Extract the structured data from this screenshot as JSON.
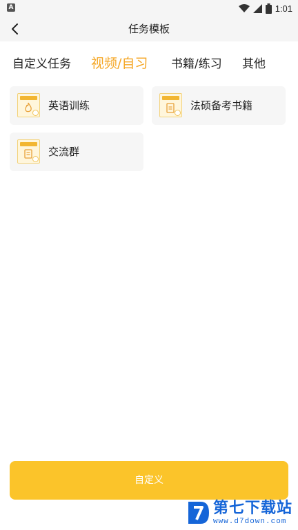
{
  "status_bar": {
    "time": "1:01",
    "icons": [
      "wifi-icon",
      "signal-icon",
      "battery-icon"
    ]
  },
  "header": {
    "title": "任务模板",
    "back_icon": "chevron-left-icon"
  },
  "tabs": [
    {
      "label": "自定义任务",
      "active": false
    },
    {
      "label": "视频/自习",
      "active": true
    },
    {
      "label": "书籍/练习",
      "active": false
    },
    {
      "label": "其他",
      "active": false
    }
  ],
  "templates": [
    {
      "label": "英语训练",
      "icon": "flame-note-icon"
    },
    {
      "label": "法硕备考书籍",
      "icon": "clipboard-note-icon"
    },
    {
      "label": "交流群",
      "icon": "notes-icon"
    }
  ],
  "bottom_button": {
    "label": "自定义"
  },
  "watermark": {
    "title": "第七下载站",
    "url": "www.d7down.com"
  },
  "colors": {
    "accent": "#f5a623",
    "button": "#fbc42a",
    "card_bg": "#f6f6f6",
    "watermark": "#1565d8"
  }
}
